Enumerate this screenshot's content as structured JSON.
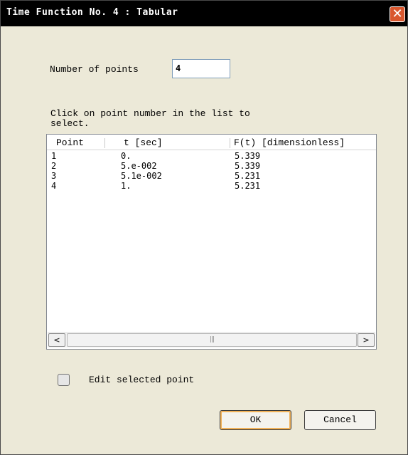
{
  "window": {
    "title": "Time Function No. 4 : Tabular",
    "close_glyph": "✕"
  },
  "points": {
    "label": "Number of points",
    "value": "4"
  },
  "instruction": {
    "line1": "Click on point number in the list to",
    "line2": "select."
  },
  "list": {
    "columns": [
      "Point",
      "t  [sec]",
      "F(t)  [dimensionless]"
    ],
    "rows": [
      [
        "1",
        "0.",
        "5.339"
      ],
      [
        "2",
        "5.e-002",
        "5.339"
      ],
      [
        "3",
        "5.1e-002",
        "5.231"
      ],
      [
        "4",
        "1.",
        "5.231"
      ]
    ],
    "scroll_left_glyph": "<",
    "scroll_right_glyph": ">",
    "thumb_grip": "|||"
  },
  "edit_checkbox": {
    "label": "Edit selected point",
    "checked": false
  },
  "buttons": {
    "ok": "OK",
    "cancel": "Cancel"
  },
  "colors": {
    "titlebar": "#000000",
    "close_button": "#d9572e",
    "dialog_bg": "#ece9d8",
    "default_button_ring": "#f1b25a"
  },
  "icons": [
    "close-icon",
    "scroll-left-arrow-icon",
    "scroll-right-arrow-icon",
    "grip-icon"
  ]
}
